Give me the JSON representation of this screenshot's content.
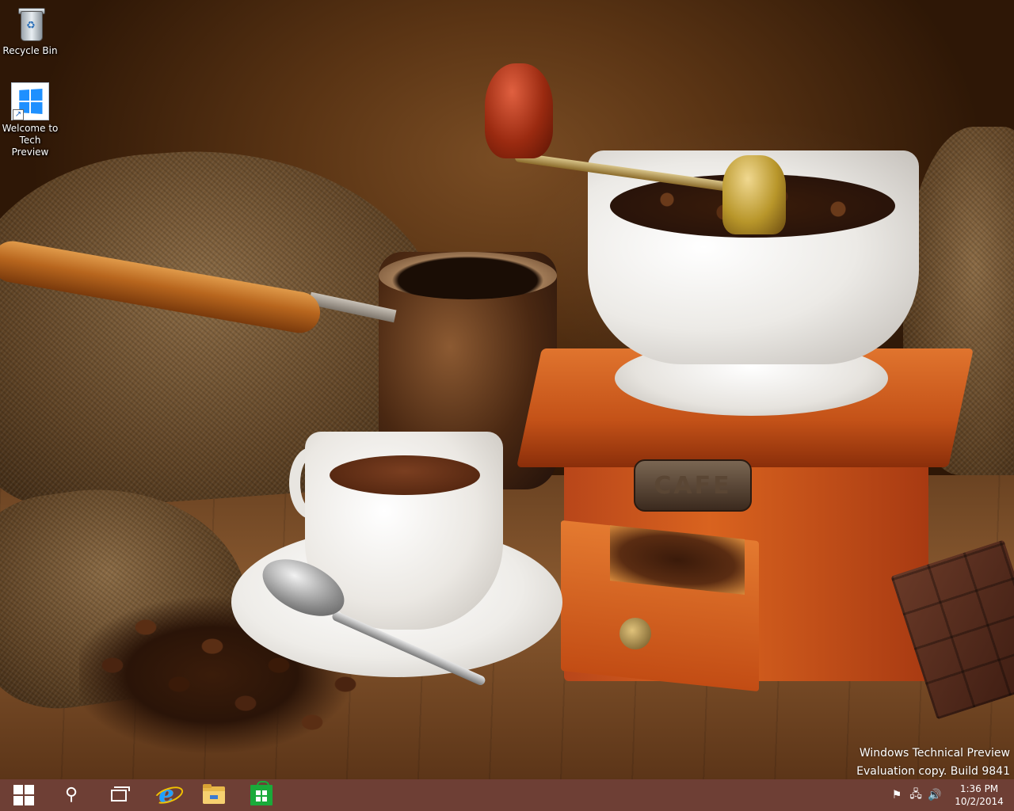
{
  "desktop": {
    "icons": [
      {
        "label": "Recycle Bin",
        "icon": "recycle-bin-icon"
      },
      {
        "label": "Welcome to\nTech Preview",
        "icon": "windows-logo-icon"
      }
    ],
    "watermark": {
      "line1": "Windows Technical Preview",
      "line2": "Evaluation copy. Build 9841"
    },
    "wallpaper": {
      "grinder_plate_text": "CAFE"
    }
  },
  "taskbar": {
    "background_color": "#784640",
    "pinned": [
      {
        "name": "start",
        "icon": "windows-start-icon"
      },
      {
        "name": "search",
        "icon": "search-icon",
        "glyph": "⚲"
      },
      {
        "name": "task-view",
        "icon": "task-view-icon"
      },
      {
        "name": "internet-explorer",
        "icon": "internet-explorer-icon",
        "glyph": "e"
      },
      {
        "name": "file-explorer",
        "icon": "folder-icon"
      },
      {
        "name": "store",
        "icon": "store-icon"
      }
    ],
    "tray": {
      "icons": [
        {
          "name": "action-center",
          "icon": "flag-icon",
          "glyph": "⚑"
        },
        {
          "name": "network",
          "icon": "network-icon",
          "glyph": "🖧"
        },
        {
          "name": "volume",
          "icon": "speaker-icon",
          "glyph": "🔊"
        }
      ],
      "time": "1:36 PM",
      "date": "10/2/2014"
    }
  }
}
